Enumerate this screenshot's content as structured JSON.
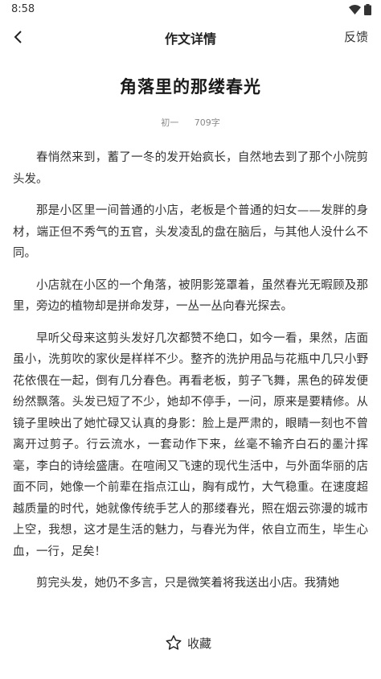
{
  "status": {
    "time": "8:58"
  },
  "nav": {
    "title": "作文详情",
    "feedback": "反馈"
  },
  "article": {
    "title": "角落里的那缕春光",
    "grade": "初一",
    "word_count": "709字",
    "paragraphs": [
      "春悄然来到，蓄了一冬的发开始疯长，自然地去到了那个小院剪头发。",
      "那是小区里一间普通的小店，老板是个普通的妇女——发胖的身材，端正但不秀气的五官，头发凌乱的盘在脑后，与其他人没什么不同。",
      "小店就在小区的一个角落，被阴影笼罩着，虽然春光无暇顾及那里，旁边的植物却是拼命发芽，一丛一丛向春光探去。",
      "早听父母来这剪头发好几次都赞不绝口，如今一看，果然，店面虽小，洗剪吹的家伙是样样不少。整齐的洗护用品与花瓶中几只小野花依偎在一起，倒有几分春色。再看老板，剪子飞舞，黑色的碎发便纷然飘落。头发已短了不少，她却不停手，一问，原来是要精修。从镜子里映出了她忙碌又认真的身影：脸上是严肃的，眼睛一刻也不曾离开过剪子。行云流水，一套动作下来，丝毫不输齐白石的墨汁挥毫，李白的诗绘盛唐。在喧闹又飞速的现代生活中，与外面华丽的店面不同，她像一个前辈在指点江山，胸有成竹，大气稳重。在速度超越质量的时代，她就像传统手艺人的那缕春光，照在烟云弥漫的城市上空，我想，这才是生活的魅力，与春光为伴，依自立而生，毕生心血，一行，足矣！",
      "剪完头发，她仍不多言，只是微笑着将我送出小店。我猜她"
    ]
  },
  "bottom": {
    "favorite": "收藏"
  },
  "icons": {
    "back": "back-arrow-icon",
    "favorite": "star-outline-icon",
    "wifi": "wifi-icon",
    "battery": "battery-icon"
  }
}
